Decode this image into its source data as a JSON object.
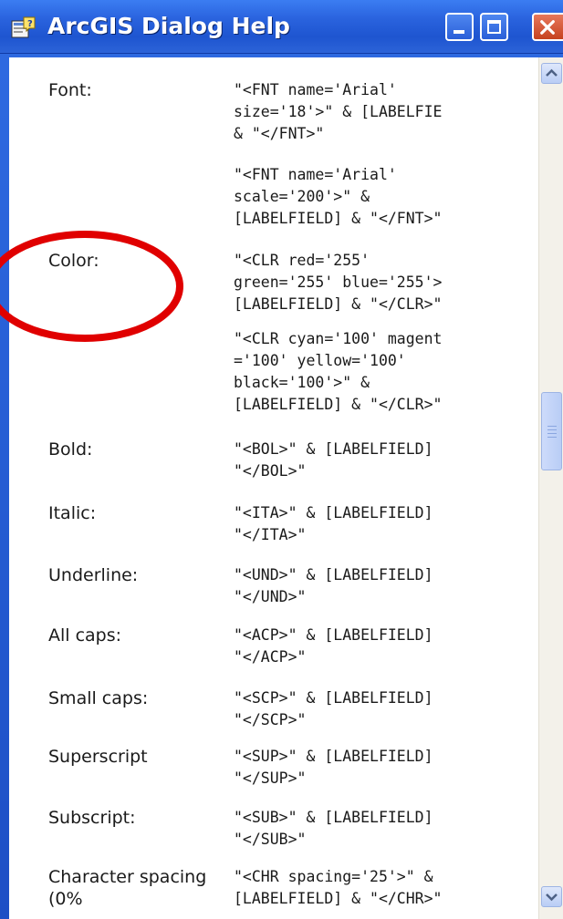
{
  "window": {
    "title": "ArcGIS Dialog Help",
    "icon": "help-book-icon",
    "buttons": [
      "minimize-icon",
      "maximize-icon",
      "close-icon"
    ]
  },
  "rows": [
    {
      "label": "Font:",
      "code": [
        "\"<FNT name='Arial'",
        "size='18'>\" & [LABELFIE",
        "& \"</FNT>\""
      ]
    },
    {
      "label": "",
      "code": [
        "\"<FNT name='Arial'",
        "scale='200'>\" &",
        "[LABELFIELD] & \"</FNT>\""
      ]
    },
    {
      "label": "Color:",
      "code": [
        "\"<CLR red='255'",
        "green='255' blue='255'>",
        "[LABELFIELD] & \"</CLR>\""
      ]
    },
    {
      "label": "",
      "code": [
        "\"<CLR cyan='100' magent",
        "='100' yellow='100'",
        "black='100'>\" &",
        "[LABELFIELD] & \"</CLR>\""
      ]
    },
    {
      "label": "Bold:",
      "code": [
        "\"<BOL>\" & [LABELFIELD]",
        "\"</BOL>\""
      ]
    },
    {
      "label": "Italic:",
      "code": [
        "\"<ITA>\" & [LABELFIELD]",
        "\"</ITA>\""
      ]
    },
    {
      "label": "Underline:",
      "code": [
        "\"<UND>\" & [LABELFIELD]",
        "\"</UND>\""
      ]
    },
    {
      "label": "All caps:",
      "code": [
        "\"<ACP>\" & [LABELFIELD]",
        "\"</ACP>\""
      ]
    },
    {
      "label": "Small caps:",
      "code": [
        "\"<SCP>\" & [LABELFIELD]",
        "\"</SCP>\""
      ]
    },
    {
      "label": "Superscript",
      "code": [
        "\"<SUP>\" & [LABELFIELD]",
        "\"</SUP>\""
      ]
    },
    {
      "label": "Subscript:",
      "code": [
        "\"<SUB>\" & [LABELFIELD]",
        "\"</SUB>\""
      ]
    },
    {
      "label": "Character spacing (0%",
      "code": [
        "\"<CHR spacing='25'>\" &",
        "[LABELFIELD] & \"</CHR>\""
      ]
    }
  ],
  "annotation": {
    "color": "#e00000",
    "shape": "ellipse-around-color-label"
  },
  "colors": {
    "titlebar": "#2a63de",
    "frame": "#1d4fc5",
    "pane": "#ffffff"
  }
}
